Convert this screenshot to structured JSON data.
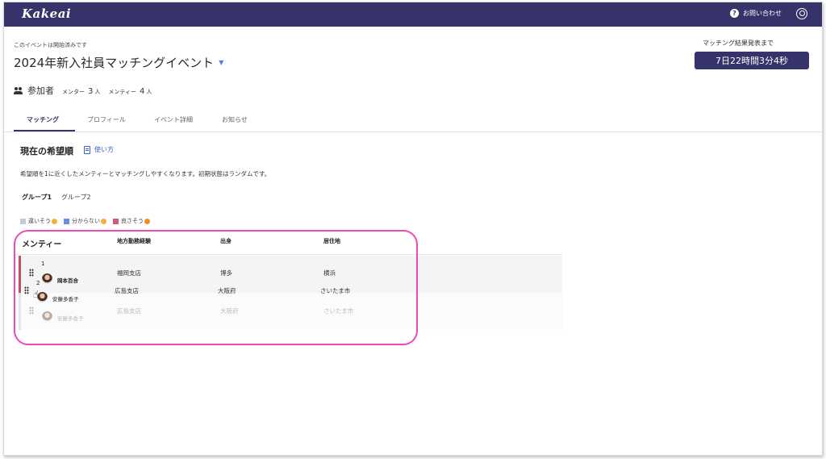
{
  "app": {
    "logo": "Kakeai"
  },
  "header": {
    "help_label": "お問い合わせ",
    "help_icon": "question-circle-icon",
    "user_icon": "user-circle-icon"
  },
  "event": {
    "status": "このイベントは開始済みです",
    "title": "2024年新入社員マッチングイベント",
    "countdown_label": "マッチング結果発表まで",
    "countdown": "7日22時間3分4秒"
  },
  "participants": {
    "label": "参加者",
    "mentor_label": "メンター",
    "mentor_count": "3",
    "mentee_label": "メンティー",
    "mentee_count": "4",
    "unit": "人"
  },
  "tabs": [
    "マッチング",
    "プロフィール",
    "イベント詳細",
    "お知らせ"
  ],
  "section": {
    "title": "現在の希望順",
    "howto": "使い方",
    "description": "希望順を1に近くしたメンティーとマッチングしやすくなります。初期状態はランダムです。"
  },
  "groups": [
    "グループ1",
    "グループ2"
  ],
  "legend": [
    {
      "label": "違いそう",
      "color": "#c9c9cf"
    },
    {
      "label": "分からない",
      "color": "#6d8de0"
    },
    {
      "label": "良さそう",
      "color": "#d4587a"
    }
  ],
  "table": {
    "headers": [
      "メンティー",
      "地方勤務経験",
      "出身",
      "居住地"
    ],
    "rows": [
      {
        "rank": "1",
        "name": "岡本百合",
        "experience": "福岡支店",
        "origin": "博多",
        "residence": "横浜"
      },
      {
        "rank": "2",
        "name": "安藤多香子",
        "experience": "広島支店",
        "origin": "大阪府",
        "residence": "さいたま市"
      }
    ]
  },
  "colors": {
    "brand": "#35336a",
    "accent_link": "#3b5fc6",
    "highlight": "#ee49b6",
    "good": "#c2506b"
  }
}
